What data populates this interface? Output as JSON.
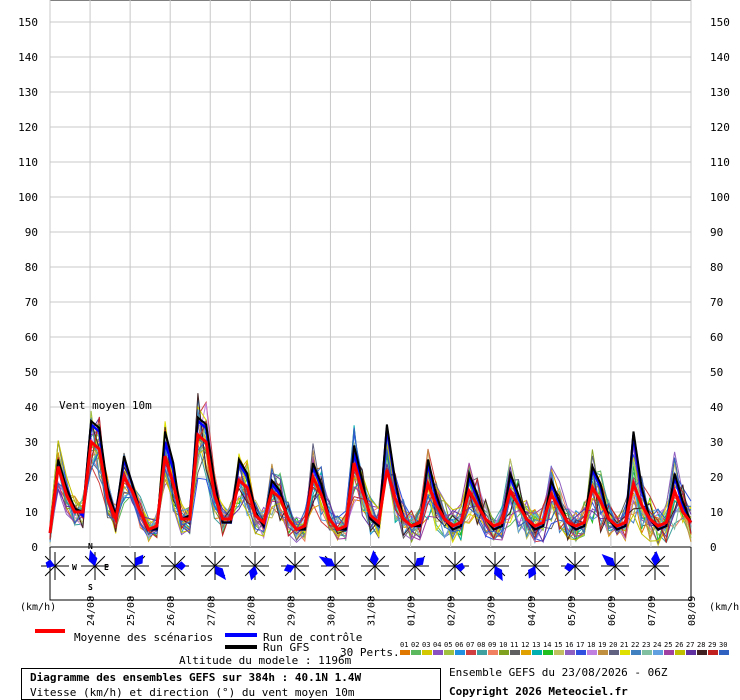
{
  "chart_data": {
    "type": "line",
    "yunit_left": "(km/h)",
    "yunit_right": "(km/h)",
    "ylim": [
      0,
      155
    ],
    "yticks": [
      0,
      10,
      20,
      30,
      40,
      50,
      60,
      70,
      80,
      90,
      100,
      110,
      120,
      130,
      140,
      150
    ],
    "grid": true,
    "inner_label": "Vent moyen 10m",
    "date_labels": [
      "24/08",
      "25/08",
      "26/08",
      "27/08",
      "28/08",
      "29/08",
      "30/08",
      "31/08",
      "01/09",
      "02/09",
      "03/09",
      "04/09",
      "05/09",
      "06/09",
      "07/09",
      "08/09"
    ],
    "x_hours_range": [
      0,
      384
    ],
    "series": [
      {
        "name": "Moyenne des scénarios",
        "color": "#ff0000",
        "values": [
          4,
          23,
          15,
          10,
          10,
          30,
          28,
          14,
          8,
          20,
          16,
          10,
          5,
          6,
          26,
          18,
          8,
          8,
          32,
          30,
          15,
          8,
          8,
          19,
          17,
          9,
          7,
          16,
          14,
          8,
          5,
          6,
          20,
          15,
          8,
          5,
          6,
          24,
          16,
          9,
          7,
          22,
          14,
          8,
          6,
          7,
          18,
          12,
          8,
          6,
          7,
          16,
          12,
          8,
          6,
          7,
          16,
          12,
          8,
          6,
          7,
          15,
          11,
          7,
          6,
          7,
          17,
          13,
          8,
          6,
          7,
          18,
          12,
          8,
          6,
          7,
          16,
          10,
          7
        ]
      },
      {
        "name": "Run de contrôle",
        "color": "#0000ff",
        "values": [
          4,
          24,
          16,
          11,
          9,
          35,
          33,
          16,
          9,
          25,
          18,
          10,
          5,
          5,
          30,
          22,
          8,
          9,
          36,
          34,
          18,
          7,
          7,
          24,
          20,
          10,
          6,
          18,
          15,
          8,
          5,
          5,
          23,
          17,
          8,
          5,
          5,
          27,
          18,
          8,
          6,
          34,
          18,
          8,
          6,
          6,
          24,
          14,
          8,
          5,
          6,
          20,
          14,
          8,
          5,
          6,
          20,
          14,
          8,
          5,
          6,
          18,
          12,
          7,
          5,
          6,
          22,
          17,
          8,
          5,
          6,
          32,
          16,
          8,
          5,
          6,
          20,
          12,
          7
        ]
      },
      {
        "name": "Run GFS",
        "color": "#000000",
        "values": [
          4,
          25,
          17,
          11,
          10,
          36,
          34,
          17,
          9,
          26,
          18,
          10,
          5,
          5,
          33,
          24,
          8,
          9,
          37,
          35,
          19,
          7,
          7,
          25,
          21,
          10,
          6,
          19,
          16,
          8,
          5,
          5,
          24,
          18,
          8,
          5,
          5,
          29,
          19,
          8,
          6,
          35,
          19,
          8,
          6,
          6,
          25,
          15,
          8,
          5,
          6,
          21,
          15,
          8,
          5,
          6,
          21,
          15,
          8,
          5,
          6,
          19,
          13,
          7,
          5,
          6,
          23,
          18,
          8,
          5,
          6,
          33,
          17,
          8,
          5,
          6,
          21,
          13,
          7
        ]
      }
    ],
    "perturbations_label": "30 Perts.",
    "perturbations": [
      "01",
      "02",
      "03",
      "04",
      "05",
      "06",
      "07",
      "08",
      "09",
      "10",
      "11",
      "12",
      "13",
      "14",
      "15",
      "16",
      "17",
      "18",
      "19",
      "20",
      "21",
      "22",
      "23",
      "24",
      "25",
      "26",
      "27",
      "28",
      "29",
      "30"
    ],
    "perturbation_colors": [
      "#e07800",
      "#5cb85c",
      "#d4c800",
      "#8a4fc0",
      "#a0c040",
      "#2090e0",
      "#d04040",
      "#40a0a0",
      "#f08060",
      "#80a020",
      "#606060",
      "#e0a000",
      "#00b0b0",
      "#20c020",
      "#c0c060",
      "#9060c0",
      "#3050e0",
      "#c080e0",
      "#c09040",
      "#606080",
      "#e0e000",
      "#4080c0",
      "#80c0a0",
      "#60a0e0",
      "#a040a0",
      "#c0c000",
      "#6030a0",
      "#402020",
      "#c02020",
      "#3060c0"
    ],
    "wind_roses": 16
  },
  "legend": {
    "mean": "Moyenne des scénarios",
    "control": "Run de contrôle",
    "gfs": "Run GFS",
    "altitude": "Altitude du modele : 1196m"
  },
  "compass": {
    "n": "N",
    "w": "W",
    "e": "E",
    "s": "S"
  },
  "footer": {
    "title": "Diagramme des ensembles GEFS sur 384h : 40.1N 1.4W",
    "subtitle": "Vitesse (km/h) et direction (°) du vent moyen 10m",
    "run": "Ensemble GEFS du 23/08/2026 - 06Z",
    "copyright": "Copyright 2026 Meteociel.fr"
  }
}
